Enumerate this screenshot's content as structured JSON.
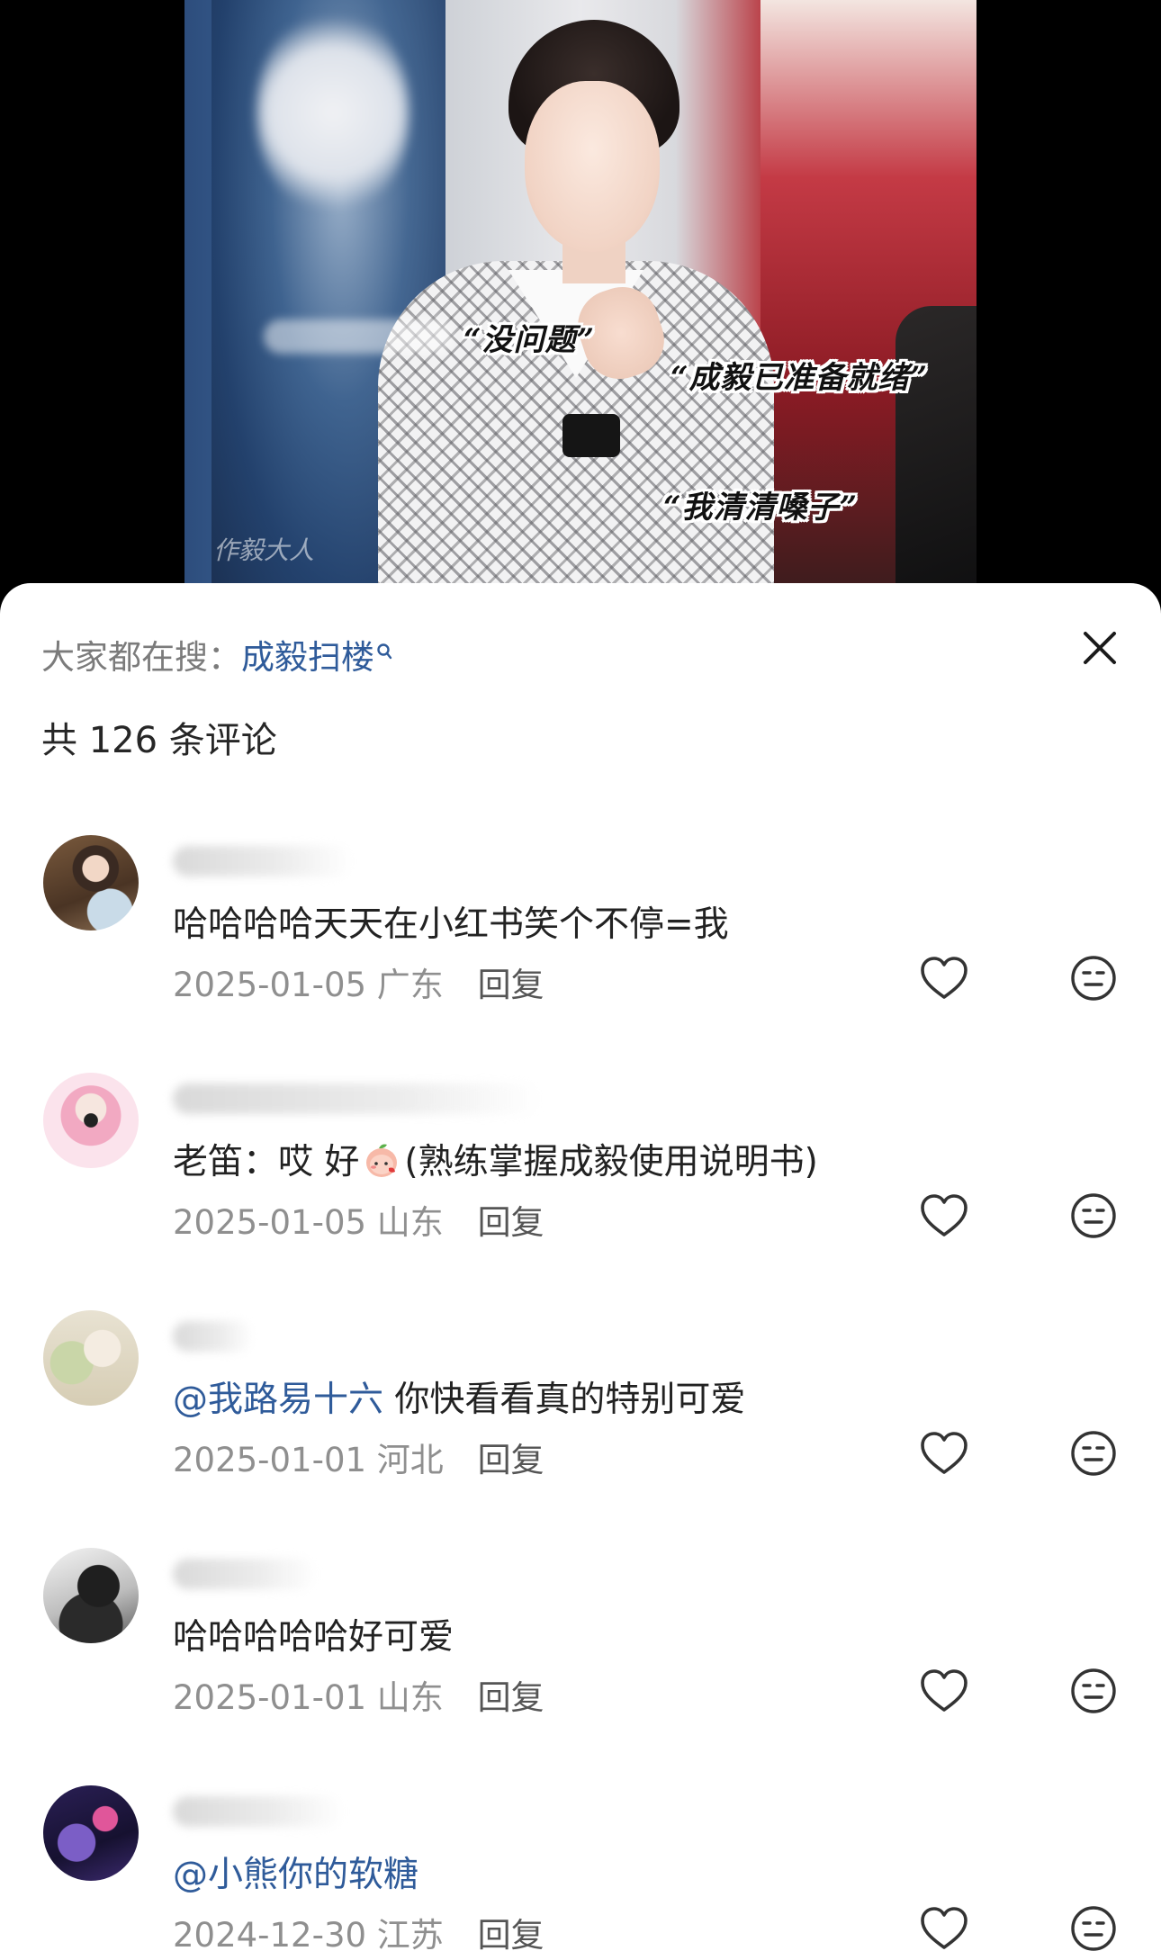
{
  "video": {
    "captions": [
      "“没问题”",
      "“成毅已准备就绪”",
      "“我清清嗓子”"
    ],
    "watermark": "作毅大人"
  },
  "sheet": {
    "search_prefix": "大家都在搜：",
    "search_term": "成毅扫楼",
    "comment_count": "共 126 条评论",
    "reply_label": "回复"
  },
  "comments": [
    {
      "mention": "",
      "text": "哈哈哈哈天天在小红书笑个不停=我",
      "date": "2025-01-05",
      "location": "广东"
    },
    {
      "mention": "",
      "text_before": "老笛：哎 好",
      "text_after": "(熟练掌握成毅使用说明书)",
      "date": "2025-01-05",
      "location": "山东"
    },
    {
      "mention": "@我路易十六",
      "text": " 你快看看真的特别可爱",
      "date": "2025-01-01",
      "location": "河北"
    },
    {
      "mention": "",
      "text": "哈哈哈哈哈好可爱",
      "date": "2025-01-01",
      "location": "山东"
    },
    {
      "mention": "@小熊你的软糖",
      "text": "",
      "date": "2024-12-30",
      "location": "江苏"
    }
  ],
  "icons": {
    "like": "heart-outline-icon",
    "emoji": "neutral-face-icon",
    "close": "close-x-icon",
    "search": "search-icon",
    "peach": "peach-emoji-icon"
  },
  "colors": {
    "mention": "#2f5b9a",
    "meta": "#8f8f8f",
    "text": "#222222"
  }
}
